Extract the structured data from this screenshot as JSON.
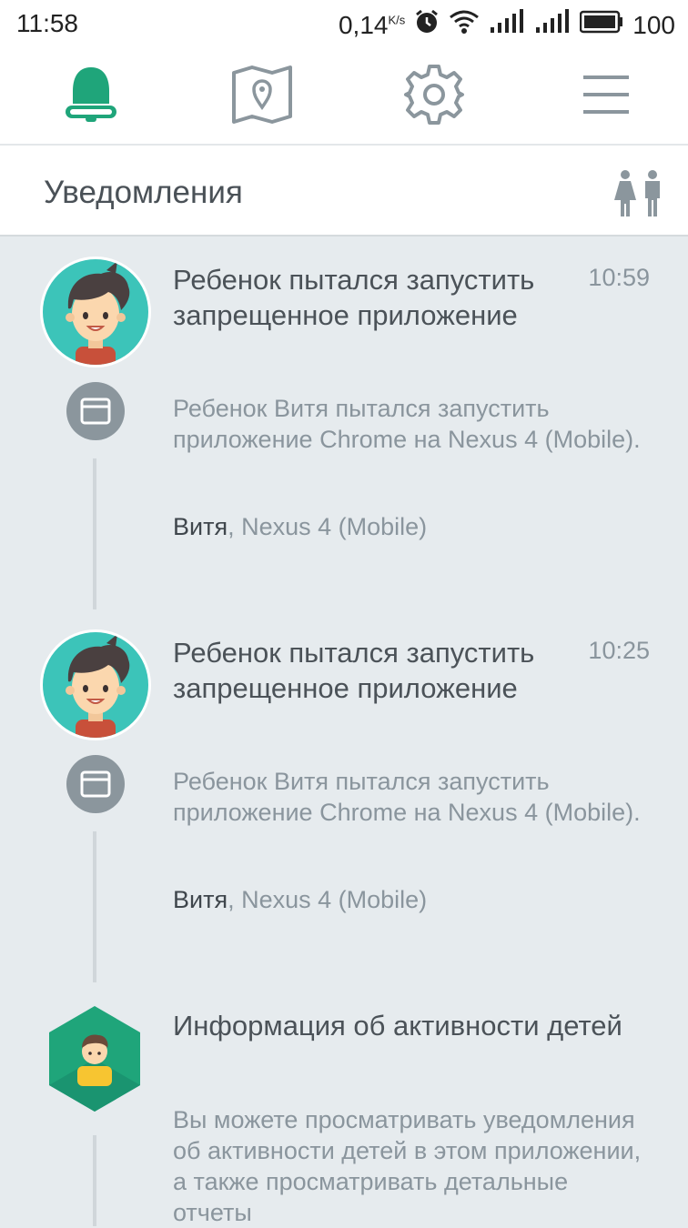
{
  "status_bar": {
    "time": "11:58",
    "net_speed": "0,14",
    "net_unit": "K/s",
    "battery": "100"
  },
  "nav": {
    "items": [
      {
        "name": "notifications",
        "icon": "bell-icon",
        "active": true
      },
      {
        "name": "map",
        "icon": "map-icon",
        "active": false
      },
      {
        "name": "settings",
        "icon": "gear-icon",
        "active": false
      },
      {
        "name": "menu",
        "icon": "menu-icon",
        "active": false
      }
    ]
  },
  "header": {
    "title": "Уведомления",
    "kids_icon": "children-icon"
  },
  "notifications": [
    {
      "title": "Ребенок пытался запустить запрещенное приложение",
      "time": "10:59",
      "description": "Ребенок Витя пытался запустить приложение Chrome на Nexus 4 (Mobile).",
      "child": "Витя",
      "device": ", Nexus 4 (Mobile)"
    },
    {
      "title": "Ребенок пытался запустить запрещенное приложение",
      "time": "10:25",
      "description": "Ребенок Витя пытался запустить приложение Chrome на Nexus 4 (Mobile).",
      "child": "Витя",
      "device": ", Nexus 4 (Mobile)"
    },
    {
      "title": "Информация об активности детей",
      "description": "Вы можете просматривать уведомления об активности детей в этом приложении, а также просматривать детальные отчеты"
    }
  ],
  "colors": {
    "accent": "#1fa57a",
    "avatar_bg": "#3cc4b9",
    "icon_gray": "#8b969d",
    "background": "#e6ebee"
  }
}
